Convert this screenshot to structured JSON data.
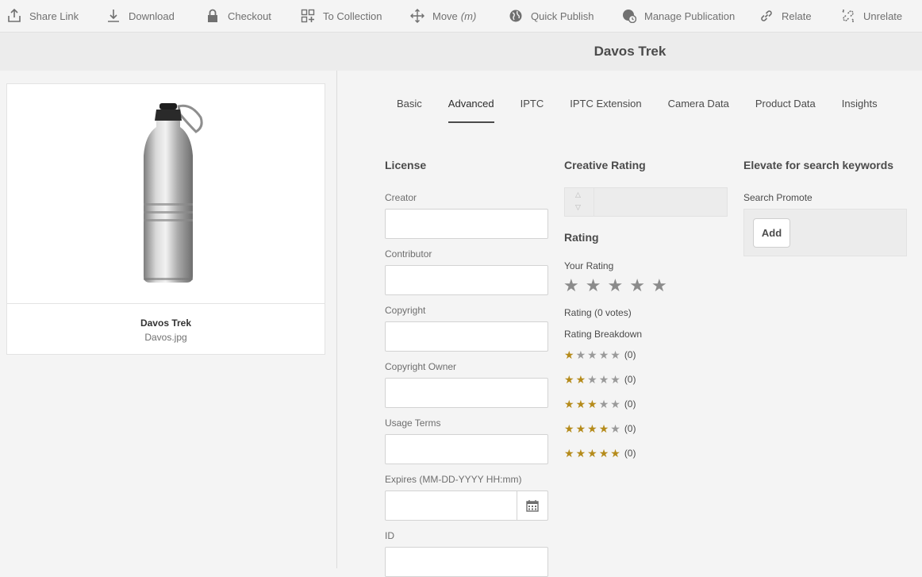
{
  "toolbar": {
    "items": [
      {
        "label": "Share Link",
        "icon": "share-icon"
      },
      {
        "label": "Download",
        "icon": "download-icon"
      },
      {
        "label": "Checkout",
        "icon": "lock-icon"
      },
      {
        "label": "To Collection",
        "icon": "collection-icon"
      },
      {
        "label": "Move",
        "hint": "(m)",
        "icon": "move-icon"
      },
      {
        "label": "Quick Publish",
        "icon": "globe-icon"
      },
      {
        "label": "Manage Publication",
        "icon": "globe-clock-icon"
      },
      {
        "label": "Relate",
        "icon": "link-icon"
      },
      {
        "label": "Unrelate",
        "icon": "unlink-icon"
      }
    ]
  },
  "page_title": "Davos Trek",
  "asset": {
    "title": "Davos Trek",
    "filename": "Davos.jpg"
  },
  "tabs": [
    "Basic",
    "Advanced",
    "IPTC",
    "IPTC Extension",
    "Camera Data",
    "Product Data",
    "Insights"
  ],
  "active_tab": "Advanced",
  "license": {
    "heading": "License",
    "fields": [
      {
        "label": "Creator",
        "value": ""
      },
      {
        "label": "Contributor",
        "value": ""
      },
      {
        "label": "Copyright",
        "value": ""
      },
      {
        "label": "Copyright Owner",
        "value": ""
      },
      {
        "label": "Usage Terms",
        "value": ""
      },
      {
        "label": "Expires (MM-DD-YYYY HH:mm)",
        "value": ""
      },
      {
        "label": "ID",
        "value": ""
      }
    ]
  },
  "creative_rating": {
    "heading": "Creative Rating",
    "value": ""
  },
  "rating": {
    "heading": "Rating",
    "your_rating_label": "Your Rating",
    "your_rating_value": 0,
    "votes_text": "Rating (0 votes)",
    "breakdown_label": "Rating Breakdown",
    "breakdown": [
      {
        "stars": 1,
        "count": "(0)"
      },
      {
        "stars": 2,
        "count": "(0)"
      },
      {
        "stars": 3,
        "count": "(0)"
      },
      {
        "stars": 4,
        "count": "(0)"
      },
      {
        "stars": 5,
        "count": "(0)"
      }
    ],
    "star_on_color": "#b58b1b",
    "star_off_color": "#9a9a9a"
  },
  "elevate": {
    "heading": "Elevate for search keywords",
    "search_promote_label": "Search Promote",
    "add_label": "Add"
  }
}
